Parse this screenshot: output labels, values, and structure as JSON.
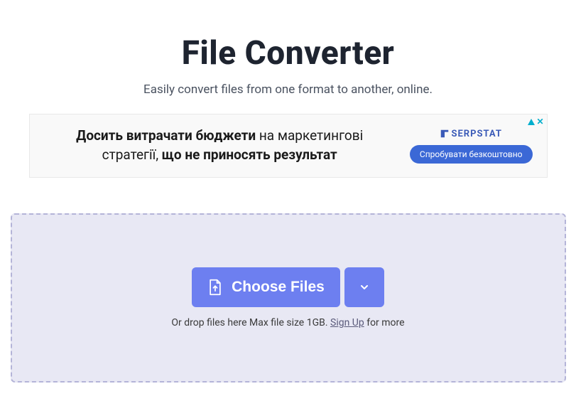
{
  "hero": {
    "title": "File Converter",
    "subtitle": "Easily convert files from one format to another, online."
  },
  "ad": {
    "line1_bold": "Досить витрачати бюджети",
    "line1_rest": " на маркетингові",
    "line2_start": "стратегії, ",
    "line2_bold": "що не приносять результат",
    "brand": "SERPSTAT",
    "cta": "Спробувати безкоштовно"
  },
  "dropzone": {
    "choose_label": "Choose Files",
    "hint_prefix": "Or drop files here Max file size 1GB. ",
    "signup_label": "Sign Up",
    "hint_suffix": " for more"
  }
}
